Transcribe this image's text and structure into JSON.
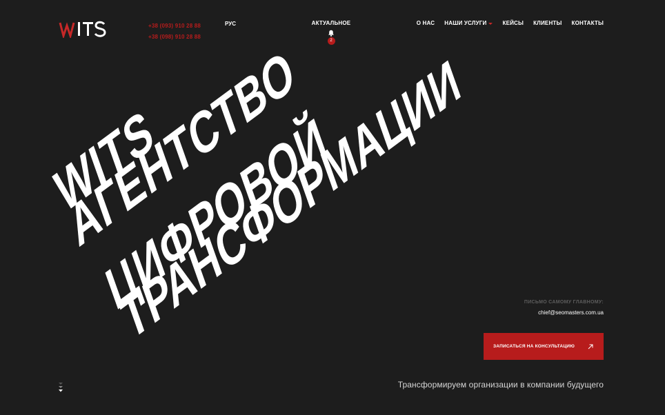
{
  "header": {
    "logo_text": "WITS",
    "phones": [
      "+38 (093) 910 28 88",
      "+38 (098) 910 28 88"
    ],
    "language": "РУС",
    "news": {
      "label": "АКТУАЛЬНОЕ",
      "badge_count": "2",
      "icon": "bell-icon"
    },
    "nav": [
      {
        "label": "О НАС"
      },
      {
        "label": "НАШИ УСЛУГИ",
        "has_dropdown": true
      },
      {
        "label": "КЕЙСЫ"
      },
      {
        "label": "КЛИЕНТЫ"
      },
      {
        "label": "КОНТАКТЫ"
      }
    ]
  },
  "hero": {
    "lines": [
      "WITS",
      "АГЕНТСТВО",
      "ЦИФРОВОЙ",
      "ТРАНСФОРМАЦИИ"
    ]
  },
  "contact": {
    "caption": "ПИСЬМО САМОМУ ГЛАВНОМУ:",
    "email": "chief@seomasters.com.ua"
  },
  "cta": {
    "label": "ЗАПИСАТЬСЯ НА КОНСУЛЬТАЦИЮ",
    "icon": "arrow-up-right-icon"
  },
  "tagline": "Трансформируем организации в компании будущего",
  "scroll": {
    "icon": "scroll-down-icon"
  },
  "colors": {
    "background": "#1d1d1d",
    "accent": "#b71c1c",
    "text": "#ffffff",
    "muted": "#5d5d5d"
  }
}
